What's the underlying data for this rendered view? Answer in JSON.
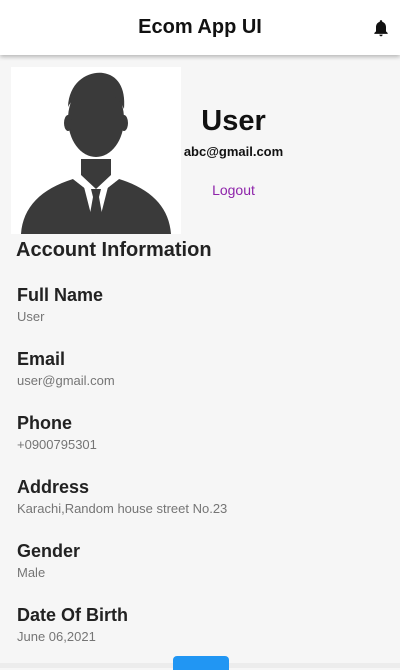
{
  "app_bar": {
    "title": "Ecom App UI",
    "notification_icon": "bell-icon"
  },
  "profile": {
    "avatar_icon": "person-silhouette-avatar",
    "name": "User",
    "email": "abc@gmail.com",
    "logout_label": "Logout",
    "logout_color": "#8e24aa"
  },
  "account_info": {
    "title": "Account Information",
    "fields": [
      {
        "label": "Full Name",
        "value": "User"
      },
      {
        "label": "Email",
        "value": "user@gmail.com"
      },
      {
        "label": "Phone",
        "value": "+0900795301"
      },
      {
        "label": "Address",
        "value": "Karachi,Random house street No.23"
      },
      {
        "label": "Gender",
        "value": "Male"
      },
      {
        "label": "Date Of Birth",
        "value": "June 06,2021"
      }
    ]
  },
  "colors": {
    "app_bar_bg": "#ffffff",
    "page_bg": "#f6f6f6",
    "button_accent": "#2196f3"
  }
}
